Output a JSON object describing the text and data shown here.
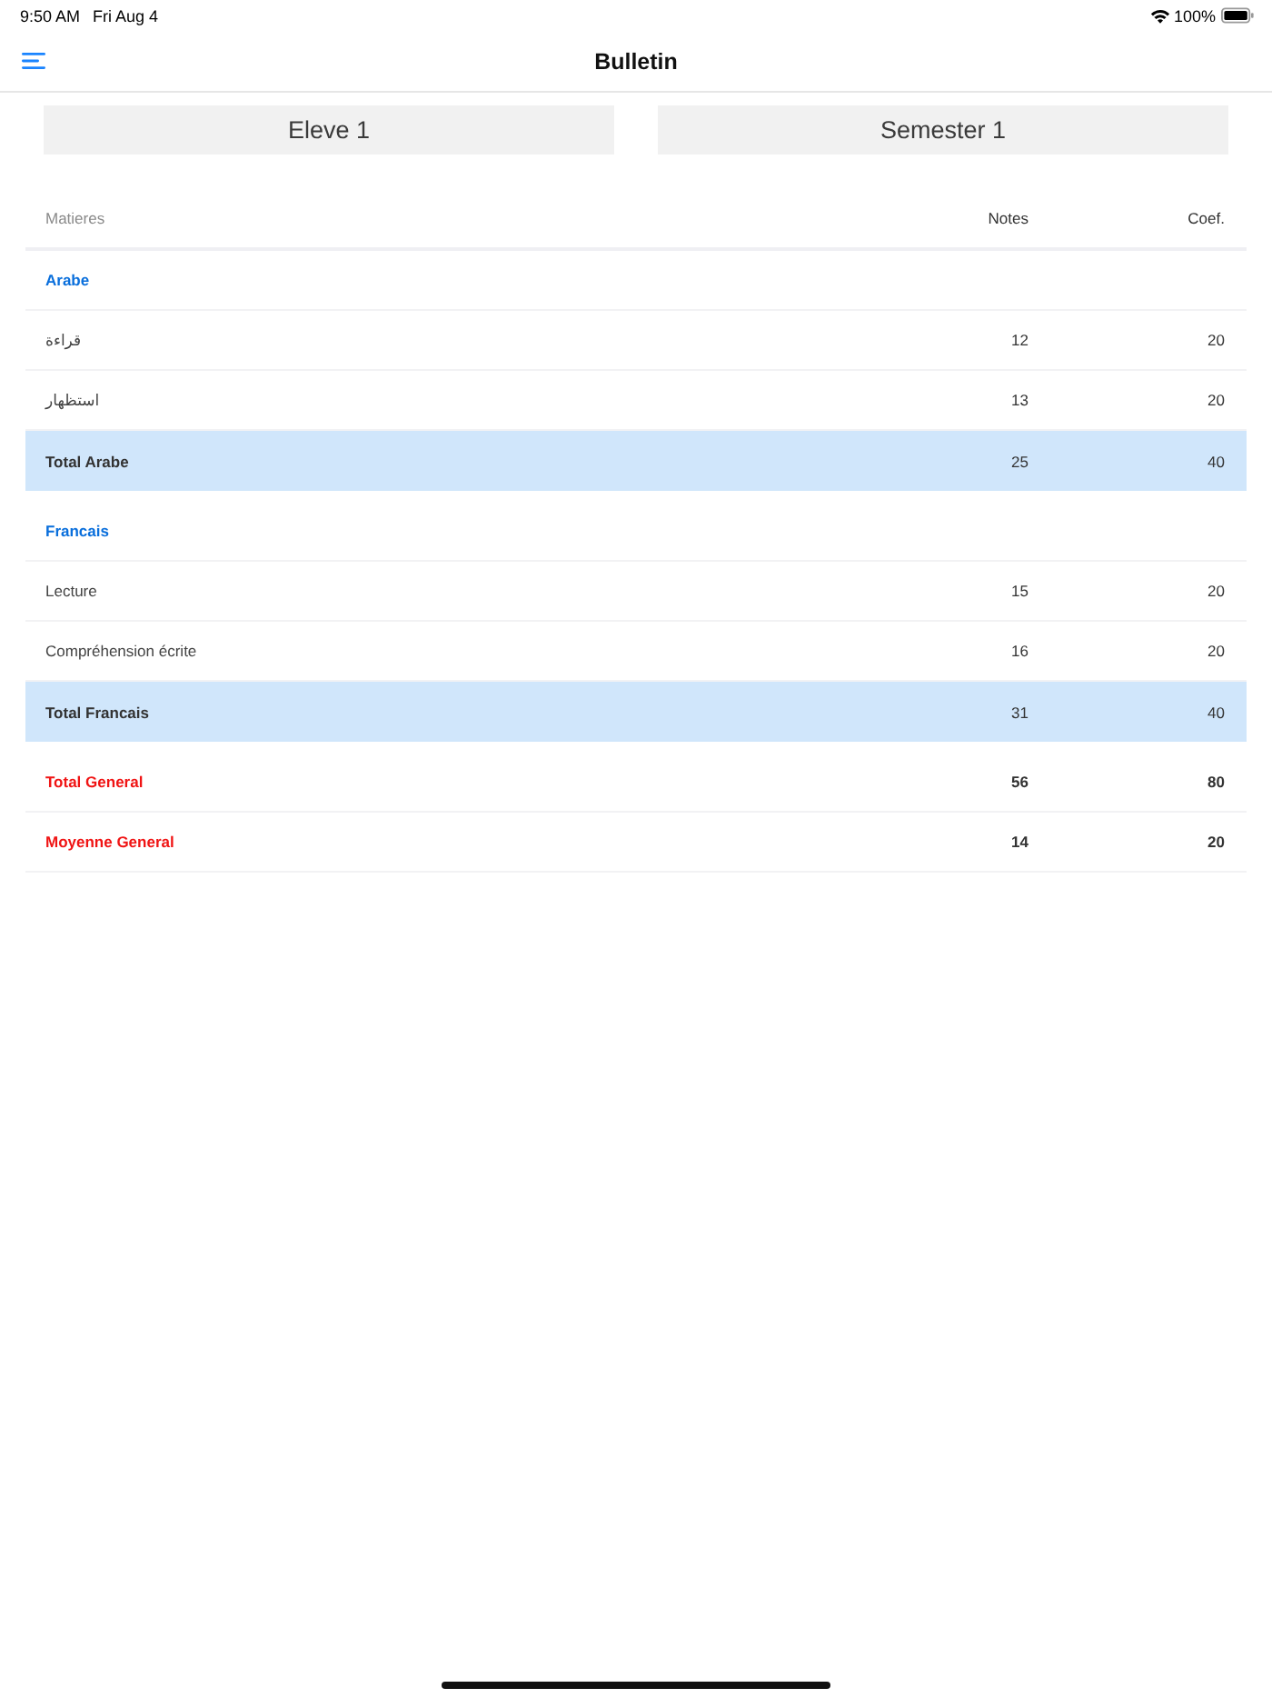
{
  "status_bar": {
    "time": "9:50 AM",
    "date": "Fri Aug 4",
    "battery": "100%"
  },
  "nav_bar": {
    "title": "Bulletin"
  },
  "selectors": [
    {
      "label": "Eleve 1"
    },
    {
      "label": "Semester 1"
    }
  ],
  "table": {
    "columns": [
      "Matieres",
      "Notes",
      "Coef."
    ],
    "rows": [
      {
        "kind": "section",
        "label": "Arabe"
      },
      {
        "kind": "subject",
        "label": "قراءة",
        "note": "12",
        "coef": "20"
      },
      {
        "kind": "subject",
        "label": "استظهار",
        "note": "13",
        "coef": "20"
      },
      {
        "kind": "total",
        "label": "Total Arabe",
        "note": "25",
        "coef": "40"
      },
      {
        "kind": "section",
        "label": "Francais"
      },
      {
        "kind": "subject",
        "label": "Lecture",
        "note": "15",
        "coef": "20"
      },
      {
        "kind": "subject",
        "label": "Compréhension écrite",
        "note": "16",
        "coef": "20"
      },
      {
        "kind": "total",
        "label": "Total Francais",
        "note": "31",
        "coef": "40"
      }
    ],
    "summary": [
      {
        "label": "Total General",
        "note": "56",
        "coef": "80"
      },
      {
        "label": "Moyenne General",
        "note": "14",
        "coef": "20"
      }
    ]
  }
}
